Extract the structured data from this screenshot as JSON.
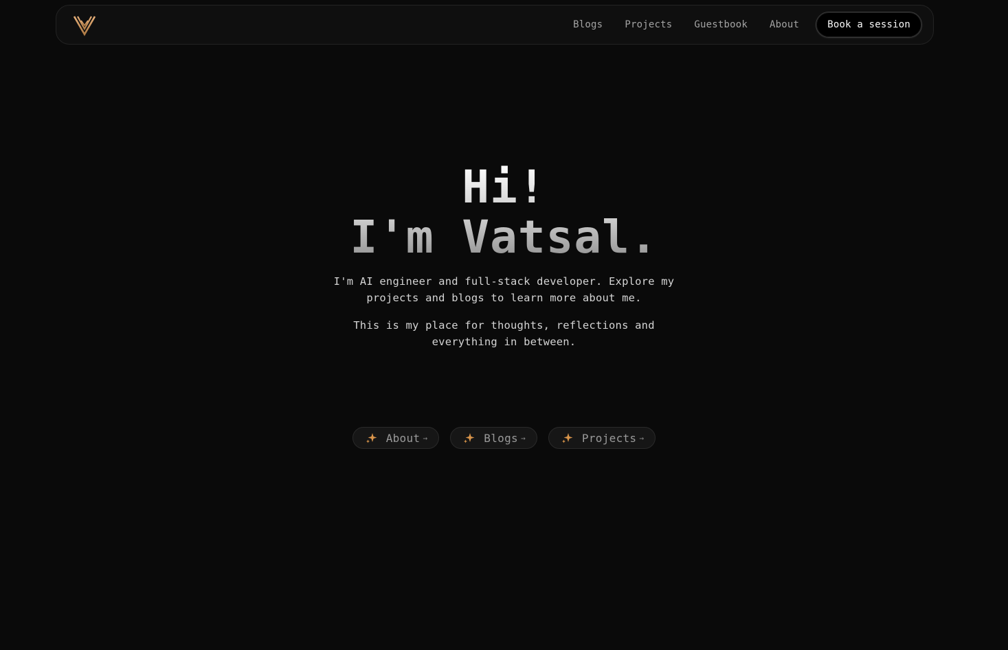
{
  "nav": {
    "logo_alt": "V",
    "links": [
      "Blogs",
      "Projects",
      "Guestbook",
      "About"
    ],
    "cta_label": "Book a session"
  },
  "hero": {
    "line1": "Hi!",
    "line2": "I'm Vatsal.",
    "intro1": "I'm AI engineer and full-stack developer. Explore my projects and blogs to learn more about me.",
    "intro2": "This is my place for thoughts, reflections and everything in between."
  },
  "cta_buttons": [
    {
      "label": "About",
      "arrow": "→",
      "icon": "sparkle-icon"
    },
    {
      "label": "Blogs",
      "arrow": "→",
      "icon": "sparkle-icon"
    },
    {
      "label": "Projects",
      "arrow": "→",
      "icon": "sparkle-icon"
    }
  ],
  "colors": {
    "background": "#0a0a0a",
    "logo_accent": "#d6a36a",
    "sparkle": "#d8944a"
  }
}
